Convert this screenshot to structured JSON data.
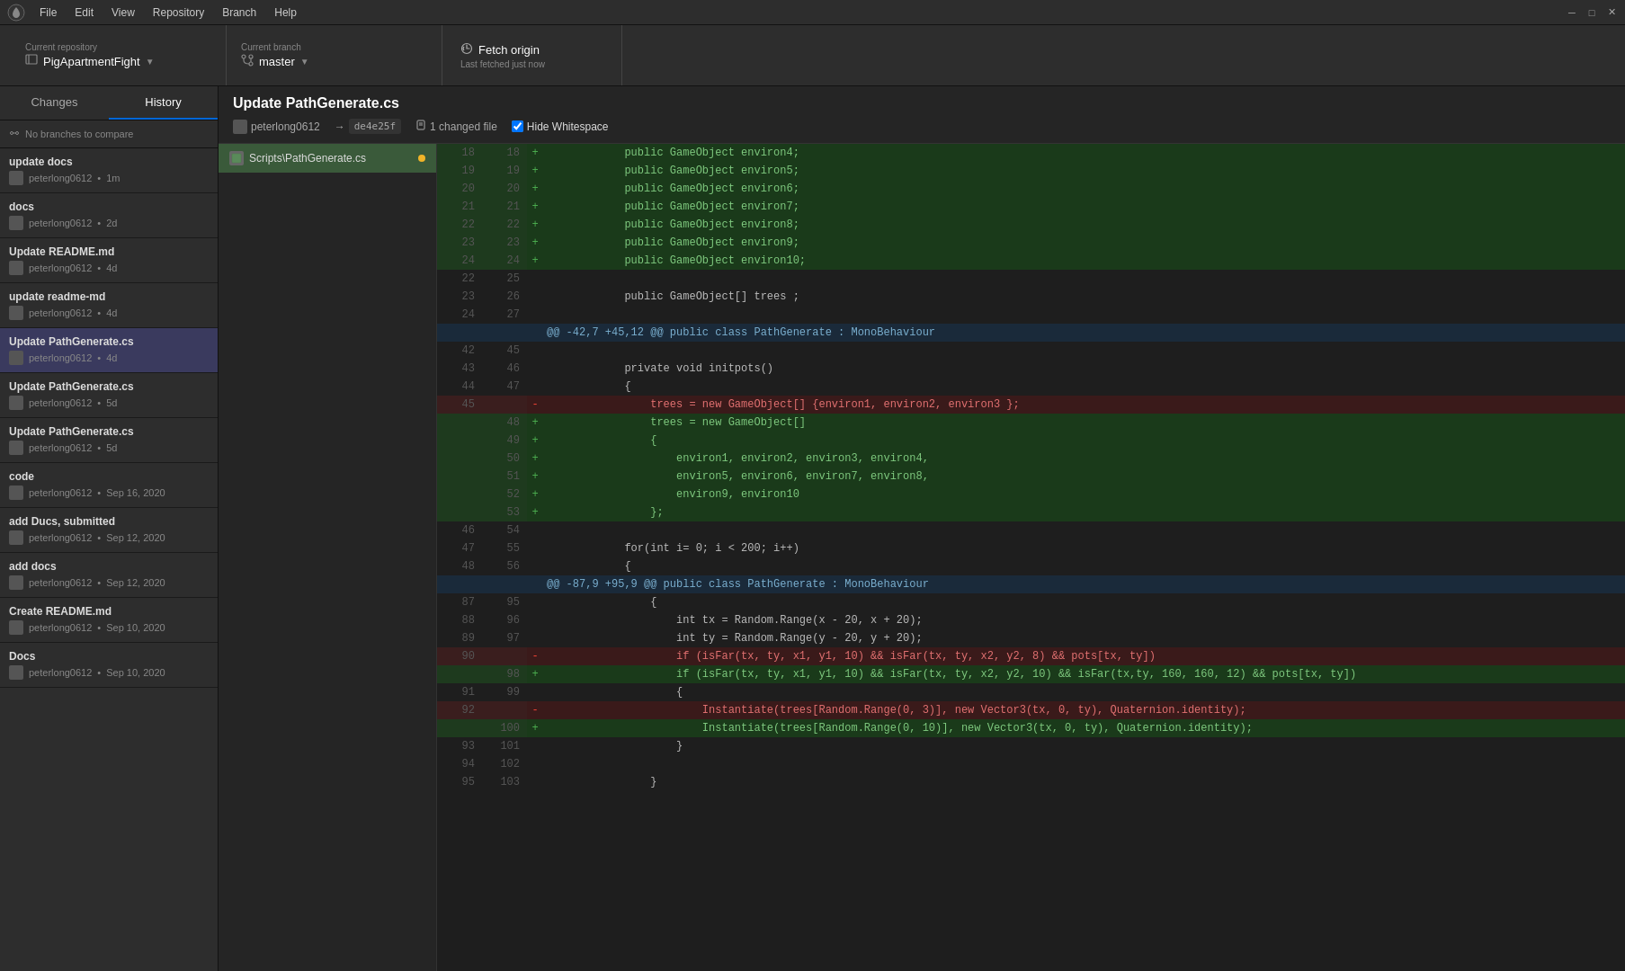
{
  "menubar": {
    "items": [
      "File",
      "Edit",
      "View",
      "Repository",
      "Branch",
      "Help"
    ],
    "app_logo": "●"
  },
  "toolbar": {
    "repo_label": "Current repository",
    "repo_name": "PigApartmentFight",
    "branch_label": "Current branch",
    "branch_name": "master",
    "fetch_label": "Fetch origin",
    "fetch_sub": "Last fetched just now"
  },
  "sidebar": {
    "tabs": [
      {
        "id": "changes",
        "label": "Changes"
      },
      {
        "id": "history",
        "label": "History"
      }
    ],
    "active_tab": "history",
    "branch_compare": "No branches to compare",
    "commits": [
      {
        "id": "c1",
        "message": "update docs",
        "author": "peterlong0612",
        "time": "1m",
        "selected": false
      },
      {
        "id": "c2",
        "message": "docs",
        "author": "peterlong0612",
        "time": "2d",
        "selected": false
      },
      {
        "id": "c3",
        "message": "Update README.md",
        "author": "peterlong0612",
        "time": "4d",
        "selected": false
      },
      {
        "id": "c4",
        "message": "update readme-md",
        "author": "peterlong0612",
        "time": "4d",
        "selected": false
      },
      {
        "id": "c5",
        "message": "Update PathGenerate.cs",
        "author": "peterlong0612",
        "time": "4d",
        "selected": true
      },
      {
        "id": "c6",
        "message": "Update PathGenerate.cs",
        "author": "peterlong0612",
        "time": "5d",
        "selected": false
      },
      {
        "id": "c7",
        "message": "Update PathGenerate.cs",
        "author": "peterlong0612",
        "time": "5d",
        "selected": false
      },
      {
        "id": "c8",
        "message": "code",
        "author": "peterlong0612",
        "time": "Sep 16, 2020",
        "selected": false
      },
      {
        "id": "c9",
        "message": "add Ducs, submitted",
        "author": "peterlong0612",
        "time": "Sep 12, 2020",
        "selected": false
      },
      {
        "id": "c10",
        "message": "add docs",
        "author": "peterlong0612",
        "time": "Sep 12, 2020",
        "selected": false
      },
      {
        "id": "c11",
        "message": "Create README.md",
        "author": "peterlong0612",
        "time": "Sep 10, 2020",
        "selected": false
      },
      {
        "id": "c12",
        "message": "Docs",
        "author": "peterlong0612",
        "time": "Sep 10, 2020",
        "selected": false
      }
    ]
  },
  "diff": {
    "title": "Update PathGenerate.cs",
    "author": "peterlong0612",
    "hash": "de4e25f",
    "changed_files_count": "1 changed file",
    "hide_whitespace_label": "Hide Whitespace",
    "file": "Scripts\\PathGenerate.cs",
    "lines": [
      {
        "type": "added",
        "old": "18",
        "new": "18",
        "sign": "+",
        "code": "            public GameObject environ4;"
      },
      {
        "type": "added",
        "old": "19",
        "new": "19",
        "sign": "+",
        "code": "            public GameObject environ5;"
      },
      {
        "type": "added",
        "old": "20",
        "new": "20",
        "sign": "+",
        "code": "            public GameObject environ6;"
      },
      {
        "type": "added",
        "old": "21",
        "new": "21",
        "sign": "+",
        "code": "            public GameObject environ7;"
      },
      {
        "type": "added",
        "old": "22",
        "new": "22",
        "sign": "+",
        "code": "            public GameObject environ8;"
      },
      {
        "type": "added",
        "old": "23",
        "new": "23",
        "sign": "+",
        "code": "            public GameObject environ9;"
      },
      {
        "type": "added",
        "old": "24",
        "new": "24",
        "sign": "+",
        "code": "            public GameObject environ10;"
      },
      {
        "type": "context",
        "old": "22",
        "new": "25",
        "sign": " ",
        "code": ""
      },
      {
        "type": "context",
        "old": "23",
        "new": "26",
        "sign": " ",
        "code": "            public GameObject[] trees ;"
      },
      {
        "type": "context",
        "old": "24",
        "new": "27",
        "sign": " ",
        "code": ""
      },
      {
        "type": "hunk",
        "old": "",
        "new": "",
        "sign": "",
        "code": "@@ -42,7 +45,12 @@ public class PathGenerate : MonoBehaviour"
      },
      {
        "type": "context",
        "old": "42",
        "new": "45",
        "sign": " ",
        "code": ""
      },
      {
        "type": "context",
        "old": "43",
        "new": "46",
        "sign": " ",
        "code": "            private void initpots()"
      },
      {
        "type": "context",
        "old": "44",
        "new": "47",
        "sign": " ",
        "code": "            {"
      },
      {
        "type": "removed",
        "old": "45",
        "new": "",
        "sign": "-",
        "code": "                trees = new GameObject[] {environ1, environ2, environ3 };"
      },
      {
        "type": "added",
        "old": "",
        "new": "48",
        "sign": "+",
        "code": "                trees = new GameObject[]"
      },
      {
        "type": "added",
        "old": "",
        "new": "49",
        "sign": "+",
        "code": "                {"
      },
      {
        "type": "added",
        "old": "",
        "new": "50",
        "sign": "+",
        "code": "                    environ1, environ2, environ3, environ4,"
      },
      {
        "type": "added",
        "old": "",
        "new": "51",
        "sign": "+",
        "code": "                    environ5, environ6, environ7, environ8,"
      },
      {
        "type": "added",
        "old": "",
        "new": "52",
        "sign": "+",
        "code": "                    environ9, environ10"
      },
      {
        "type": "added",
        "old": "",
        "new": "53",
        "sign": "+",
        "code": "                };"
      },
      {
        "type": "context",
        "old": "46",
        "new": "54",
        "sign": " ",
        "code": ""
      },
      {
        "type": "context",
        "old": "47",
        "new": "55",
        "sign": " ",
        "code": "            for(int i= 0; i < 200; i++)"
      },
      {
        "type": "context",
        "old": "48",
        "new": "56",
        "sign": " ",
        "code": "            {"
      },
      {
        "type": "hunk",
        "old": "",
        "new": "",
        "sign": "",
        "code": "@@ -87,9 +95,9 @@ public class PathGenerate : MonoBehaviour"
      },
      {
        "type": "context",
        "old": "87",
        "new": "95",
        "sign": " ",
        "code": "                {"
      },
      {
        "type": "context",
        "old": "88",
        "new": "96",
        "sign": " ",
        "code": "                    int tx = Random.Range(x - 20, x + 20);"
      },
      {
        "type": "context",
        "old": "89",
        "new": "97",
        "sign": " ",
        "code": "                    int ty = Random.Range(y - 20, y + 20);"
      },
      {
        "type": "removed",
        "old": "90",
        "new": "",
        "sign": "-",
        "code": "                    if (isFar(tx, ty, x1, y1, 10) && isFar(tx, ty, x2, y2, 8) && pots[tx, ty])"
      },
      {
        "type": "added",
        "old": "",
        "new": "98",
        "sign": "+",
        "code": "                    if (isFar(tx, ty, x1, y1, 10) && isFar(tx, ty, x2, y2, 10) && isFar(tx,ty, 160, 160, 12) && pots[tx, ty])"
      },
      {
        "type": "context",
        "old": "91",
        "new": "99",
        "sign": " ",
        "code": "                    {"
      },
      {
        "type": "removed",
        "old": "92",
        "new": "",
        "sign": "-",
        "code": "                        Instantiate(trees[Random.Range(0, 3)], new Vector3(tx, 0, ty), Quaternion.identity);"
      },
      {
        "type": "added",
        "old": "",
        "new": "100",
        "sign": "+",
        "code": "                        Instantiate(trees[Random.Range(0, 10)], new Vector3(tx, 0, ty), Quaternion.identity);"
      },
      {
        "type": "context",
        "old": "93",
        "new": "101",
        "sign": " ",
        "code": "                    }"
      },
      {
        "type": "context",
        "old": "94",
        "new": "102",
        "sign": " ",
        "code": ""
      },
      {
        "type": "context",
        "old": "95",
        "new": "103",
        "sign": " ",
        "code": "                }"
      }
    ]
  }
}
